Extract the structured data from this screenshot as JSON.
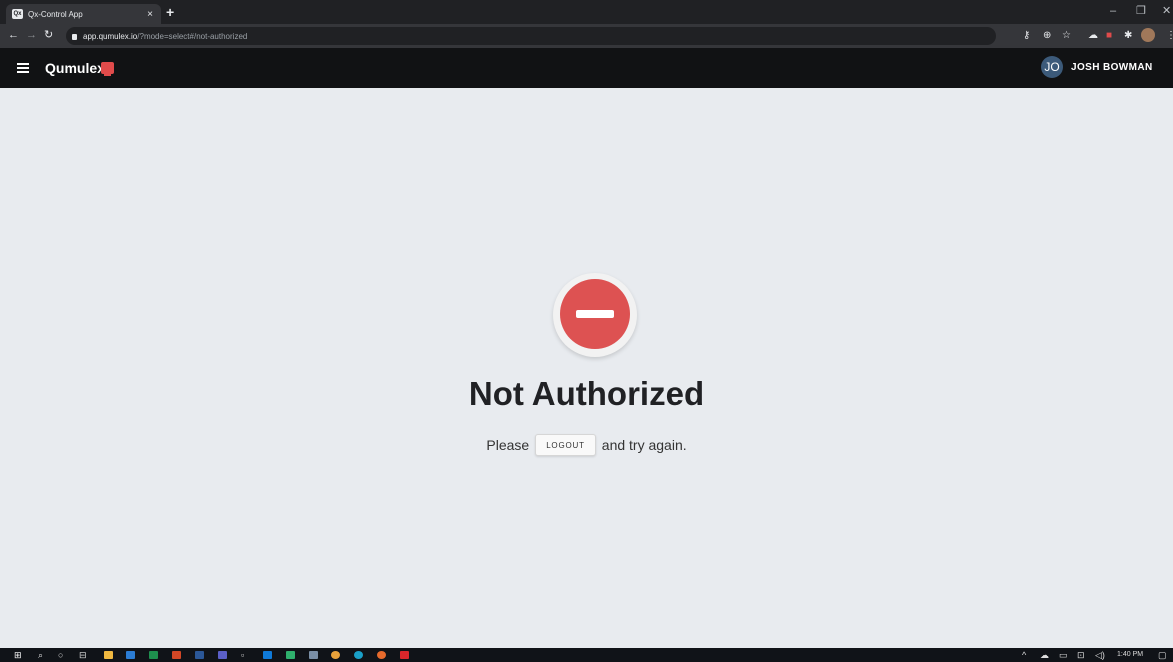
{
  "browser": {
    "tab": {
      "favicon_text": "Qx",
      "title": "Qx-Control App"
    },
    "url": {
      "host": "app.qumulex.io",
      "path": "/?mode=select#/not-authorized"
    }
  },
  "appbar": {
    "brand": "Qumulex",
    "avatar_initials": "JO",
    "user_name": "JOSH BOWMAN"
  },
  "main": {
    "title": "Not Authorized",
    "message_before": "Please",
    "logout_label": "LOGOUT",
    "message_after": "and try again."
  },
  "taskbar": {
    "time": "1:40 PM"
  },
  "colors": {
    "appbar_bg": "#111214",
    "page_bg": "#e8ebef",
    "denied_red": "#dd5252",
    "brand_red": "#e04b4b"
  },
  "icons": {
    "browser": [
      "back-arrow-icon",
      "forward-arrow-icon",
      "reload-icon",
      "lock-icon",
      "key-icon",
      "install-icon",
      "star-icon",
      "extension-icon",
      "puzzle-icon",
      "profile-icon",
      "menu-kebab-icon"
    ],
    "taskbar": [
      "windows-start-icon",
      "search-icon",
      "cortana-icon",
      "task-view-icon",
      "file-explorer-icon",
      "outlook-icon",
      "excel-icon",
      "powerpoint-icon",
      "word-icon",
      "teams-icon",
      "chrome-icon",
      "edge-icon",
      "firefox-icon",
      "acrobat-icon"
    ]
  }
}
